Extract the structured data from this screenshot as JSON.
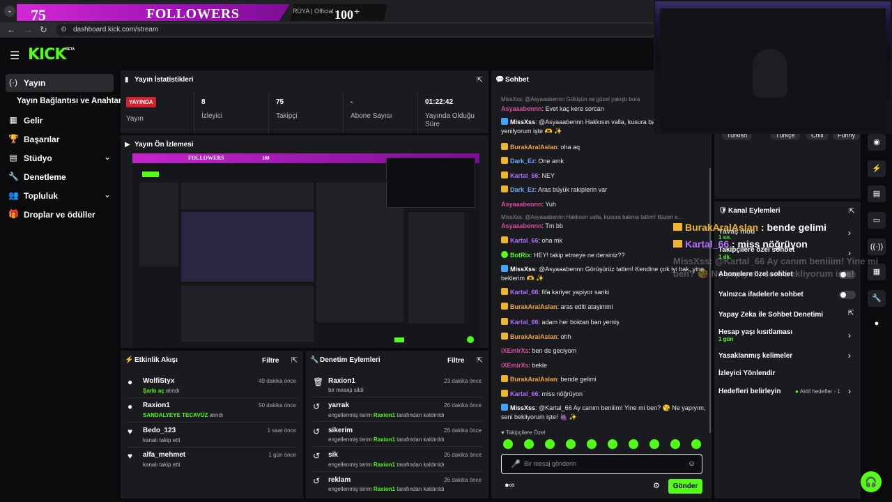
{
  "overlay": {
    "followers_count": "75",
    "followers_title": "FOLLOWERS",
    "goal_count": "100",
    "tab_text": "RÜYA | Official"
  },
  "browser": {
    "url": "dashboard.kick.com/stream"
  },
  "sidebar": {
    "items": [
      {
        "label": "Yayın",
        "icon": "broadcast-icon"
      },
      {
        "label": "Yayın Bağlantısı ve Anahtarı",
        "icon": ""
      },
      {
        "label": "Gelir",
        "icon": "revenue-icon"
      },
      {
        "label": "Başarılar",
        "icon": "trophy-icon"
      },
      {
        "label": "Stüdyo",
        "icon": "studio-icon"
      },
      {
        "label": "Denetleme",
        "icon": "wrench-icon"
      },
      {
        "label": "Topluluk",
        "icon": "community-icon"
      },
      {
        "label": "Droplar ve ödüller",
        "icon": "gift-icon"
      }
    ]
  },
  "stats": {
    "title": "Yayın İstatistikleri",
    "live_badge": "YAYINDA",
    "live_label": "Yayın",
    "viewers_value": "8",
    "viewers_label": "İzleyici",
    "followers_value": "75",
    "followers_label": "Takipçi",
    "subs_value": "-",
    "subs_label": "Abone Sayısı",
    "uptime_value": "01:22:42",
    "uptime_label": "Yayında Olduğu Süre"
  },
  "preview": {
    "title": "Yayın Ön İzlemesi",
    "banner_text": "FOLLOWERS",
    "goal_text": "100"
  },
  "activity": {
    "title": "Etkinlik Akışı",
    "filter": "Filtre",
    "rows": [
      {
        "name": "WolfiStyx",
        "highlight": "Şarkı aç",
        "suffix": " alındı",
        "time": "49 dakika önce"
      },
      {
        "name": "Raxion1",
        "highlight": "SANDALYEYE TECAVÜZ",
        "suffix": " alındı",
        "time": "50 dakika önce"
      },
      {
        "name": "Bedo_123",
        "sub": "kanalı takip etti",
        "time": "1 saat önce"
      },
      {
        "name": "alfa_mehmet",
        "sub": "kanalı takip etti",
        "time": "1 gün önce"
      }
    ]
  },
  "moderation": {
    "title": "Denetim Eylemleri",
    "filter": "Filtre",
    "rows": [
      {
        "name": "Raxion1",
        "sub": "bir mesajı sildi",
        "time": "23 dakika önce"
      },
      {
        "name": "yarrak",
        "pre": "engellenmiş terim ",
        "mod": "Raxion1",
        "post": " tarafından kaldırıldı",
        "time": "26 dakika önce"
      },
      {
        "name": "sikerim",
        "pre": "engellenmiş terim ",
        "mod": "Raxion1",
        "post": " tarafından kaldırıldı",
        "time": "26 dakika önce"
      },
      {
        "name": "sik",
        "pre": "engellenmiş terim ",
        "mod": "Raxion1",
        "post": " tarafından kaldırıldı",
        "time": "26 dakika önce"
      },
      {
        "name": "reklam",
        "pre": "engellenmiş terim ",
        "mod": "Raxion1",
        "post": " tarafından kaldırıldı",
        "time": "26 dakika önce"
      }
    ]
  },
  "chat": {
    "title": "Sohbet",
    "reply1": "MissXss: @Asyaaabennn Gülüşün ne güzel yakıştı bura",
    "reply2": "MissXss: @Asyaaabennn Hakkısın valla, kusura bakma tatlım! Bazen e...",
    "messages": [
      {
        "user": "Asyaaabennn",
        "color": "#e04aa0",
        "badge": "",
        "text": ": Evet kaç kere sorcan"
      },
      {
        "user": "MissXss",
        "color": "#ffffff",
        "badge": "share",
        "text": ": @Asyaaabennn Hakkısın valla, kusura ba Bazen enerjime yenilyorum işte 🫶 ✨"
      },
      {
        "user": "BurakAralAslan",
        "color": "#f0a43c",
        "badge": "crown",
        "text": ": oha aq"
      },
      {
        "user": "Dark_Ez",
        "color": "#6fa8ff",
        "badge": "crown",
        "text": ": One amk"
      },
      {
        "user": "Kartal_66",
        "color": "#b06cff",
        "badge": "crown",
        "text": ": NEY"
      },
      {
        "user": "Dark_Ez",
        "color": "#6fa8ff",
        "badge": "crown",
        "text": ": Aras büyük rakiplerin var"
      },
      {
        "user": "Asyaaabennn",
        "color": "#e04aa0",
        "badge": "",
        "text": ": Yuh"
      },
      {
        "user": "Asyaaabennn",
        "color": "#e04aa0",
        "badge": "",
        "text": ": Tm bb"
      },
      {
        "user": "Kartal_66",
        "color": "#b06cff",
        "badge": "crown",
        "text": ": oha mk"
      },
      {
        "user": "BotRix",
        "color": "#53fc18",
        "badge": "bot",
        "text": ": HEY! takip etmeye ne dersiniz??"
      },
      {
        "user": "MissXss",
        "color": "#ffffff",
        "badge": "share",
        "text": ": @Asyaaabennn Görüşürüz tatlım! Kendine çok iyi bak, yine beklerim 🫶 ✨"
      },
      {
        "user": "Kartal_66",
        "color": "#b06cff",
        "badge": "crown",
        "text": ": fifa kariyer yapiyor sanki"
      },
      {
        "user": "BurakAralAslan",
        "color": "#f0a43c",
        "badge": "crown",
        "text": ": aras editi atayimmi"
      },
      {
        "user": "Kartal_66",
        "color": "#b06cff",
        "badge": "crown",
        "text": ": adam her boktan ban yemiş"
      },
      {
        "user": "BurakAralAslan",
        "color": "#f0a43c",
        "badge": "crown",
        "text": ": ohh"
      },
      {
        "user": "iXEmirXs",
        "color": "#e04aa0",
        "badge": "",
        "text": ": ben de geciyom"
      },
      {
        "user": "iXEmirXs",
        "color": "#e04aa0",
        "badge": "",
        "text": ": bekle"
      },
      {
        "user": "BurakAralAslan",
        "color": "#f0a43c",
        "badge": "crown",
        "text": ": bende gelimi"
      },
      {
        "user": "Kartal_66",
        "color": "#b06cff",
        "badge": "crown",
        "text": ": miss nöğrüyon"
      },
      {
        "user": "MissXss",
        "color": "#ffffff",
        "badge": "share",
        "text": ": @Kartal_66 Ay canım beniiim! Yine mi ben? 😘 Ne yapıyım, seni bekliyorum işte! 🍇 ✨"
      }
    ],
    "followers_only_label": "Takipçilere Özel",
    "input_placeholder": "Bir mesaj gönderin",
    "send_label": "Gönder"
  },
  "tags": [
    "Turkish",
    "Türkçe",
    "Chill",
    "Funny"
  ],
  "channel_actions": {
    "title": "Kanal Eylemleri",
    "slow_mode_label": "Yavaş mod",
    "slow_mode_value": "1 sn.",
    "followers_only_label": "Takipçilere özel sohbet",
    "followers_only_value": "1 dk.",
    "subs_only_label": "Abonelere özel sohbet",
    "emotes_only_label": "Yalnızca ifadelerle sohbet",
    "ai_mod_label": "Yapay Zeka ile Sohbet Denetimi",
    "age_label": "Hesap yaşı kısıtlaması",
    "age_value": "1 gün",
    "banned_words_label": "Yasaklanmış kelimeler",
    "redirect_label": "İzleyici Yönlendir",
    "goals_label": "Hedefleri belirleyin",
    "goals_status": "Aktif hedefler - 1"
  },
  "floating": {
    "msg1_user": "BurakAralAslan",
    "msg1_text": " : bende gelimi",
    "msg2_user": "Kartal_66",
    "msg2_text": " : miss nöğrüyon",
    "ghost_text": "MissXss: @Kartal_66 Ay canım beniiim! Yine mi ben? 😘 Ne yapıyım, seni bekliyorum işte!"
  },
  "colors": {
    "accent": "#53fc18",
    "live": "#d6202b",
    "panel": "#191b1f",
    "overlay_pink": "#c225c9"
  }
}
